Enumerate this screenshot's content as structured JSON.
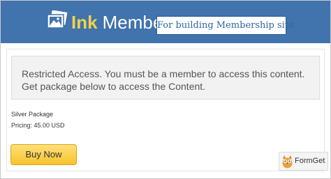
{
  "header": {
    "brand_part1": "Ink",
    "brand_part2": "Member",
    "tagline": "For building Membership site",
    "logo_icon": "picture-frame-icon"
  },
  "notice": {
    "message": "Restricted Access. You must be a member to access this content. Get package below to access the Content."
  },
  "package": {
    "name": "Silver Package",
    "pricing": "Pricing: 45.00 USD"
  },
  "buy_button": {
    "label": "Buy Now"
  },
  "watermark": {
    "text": "FormGet",
    "icon": "owl-icon"
  },
  "colors": {
    "header_bg": "#4173ad",
    "brand_accent": "#f1d34a",
    "button_bg": "#f8c32b"
  }
}
